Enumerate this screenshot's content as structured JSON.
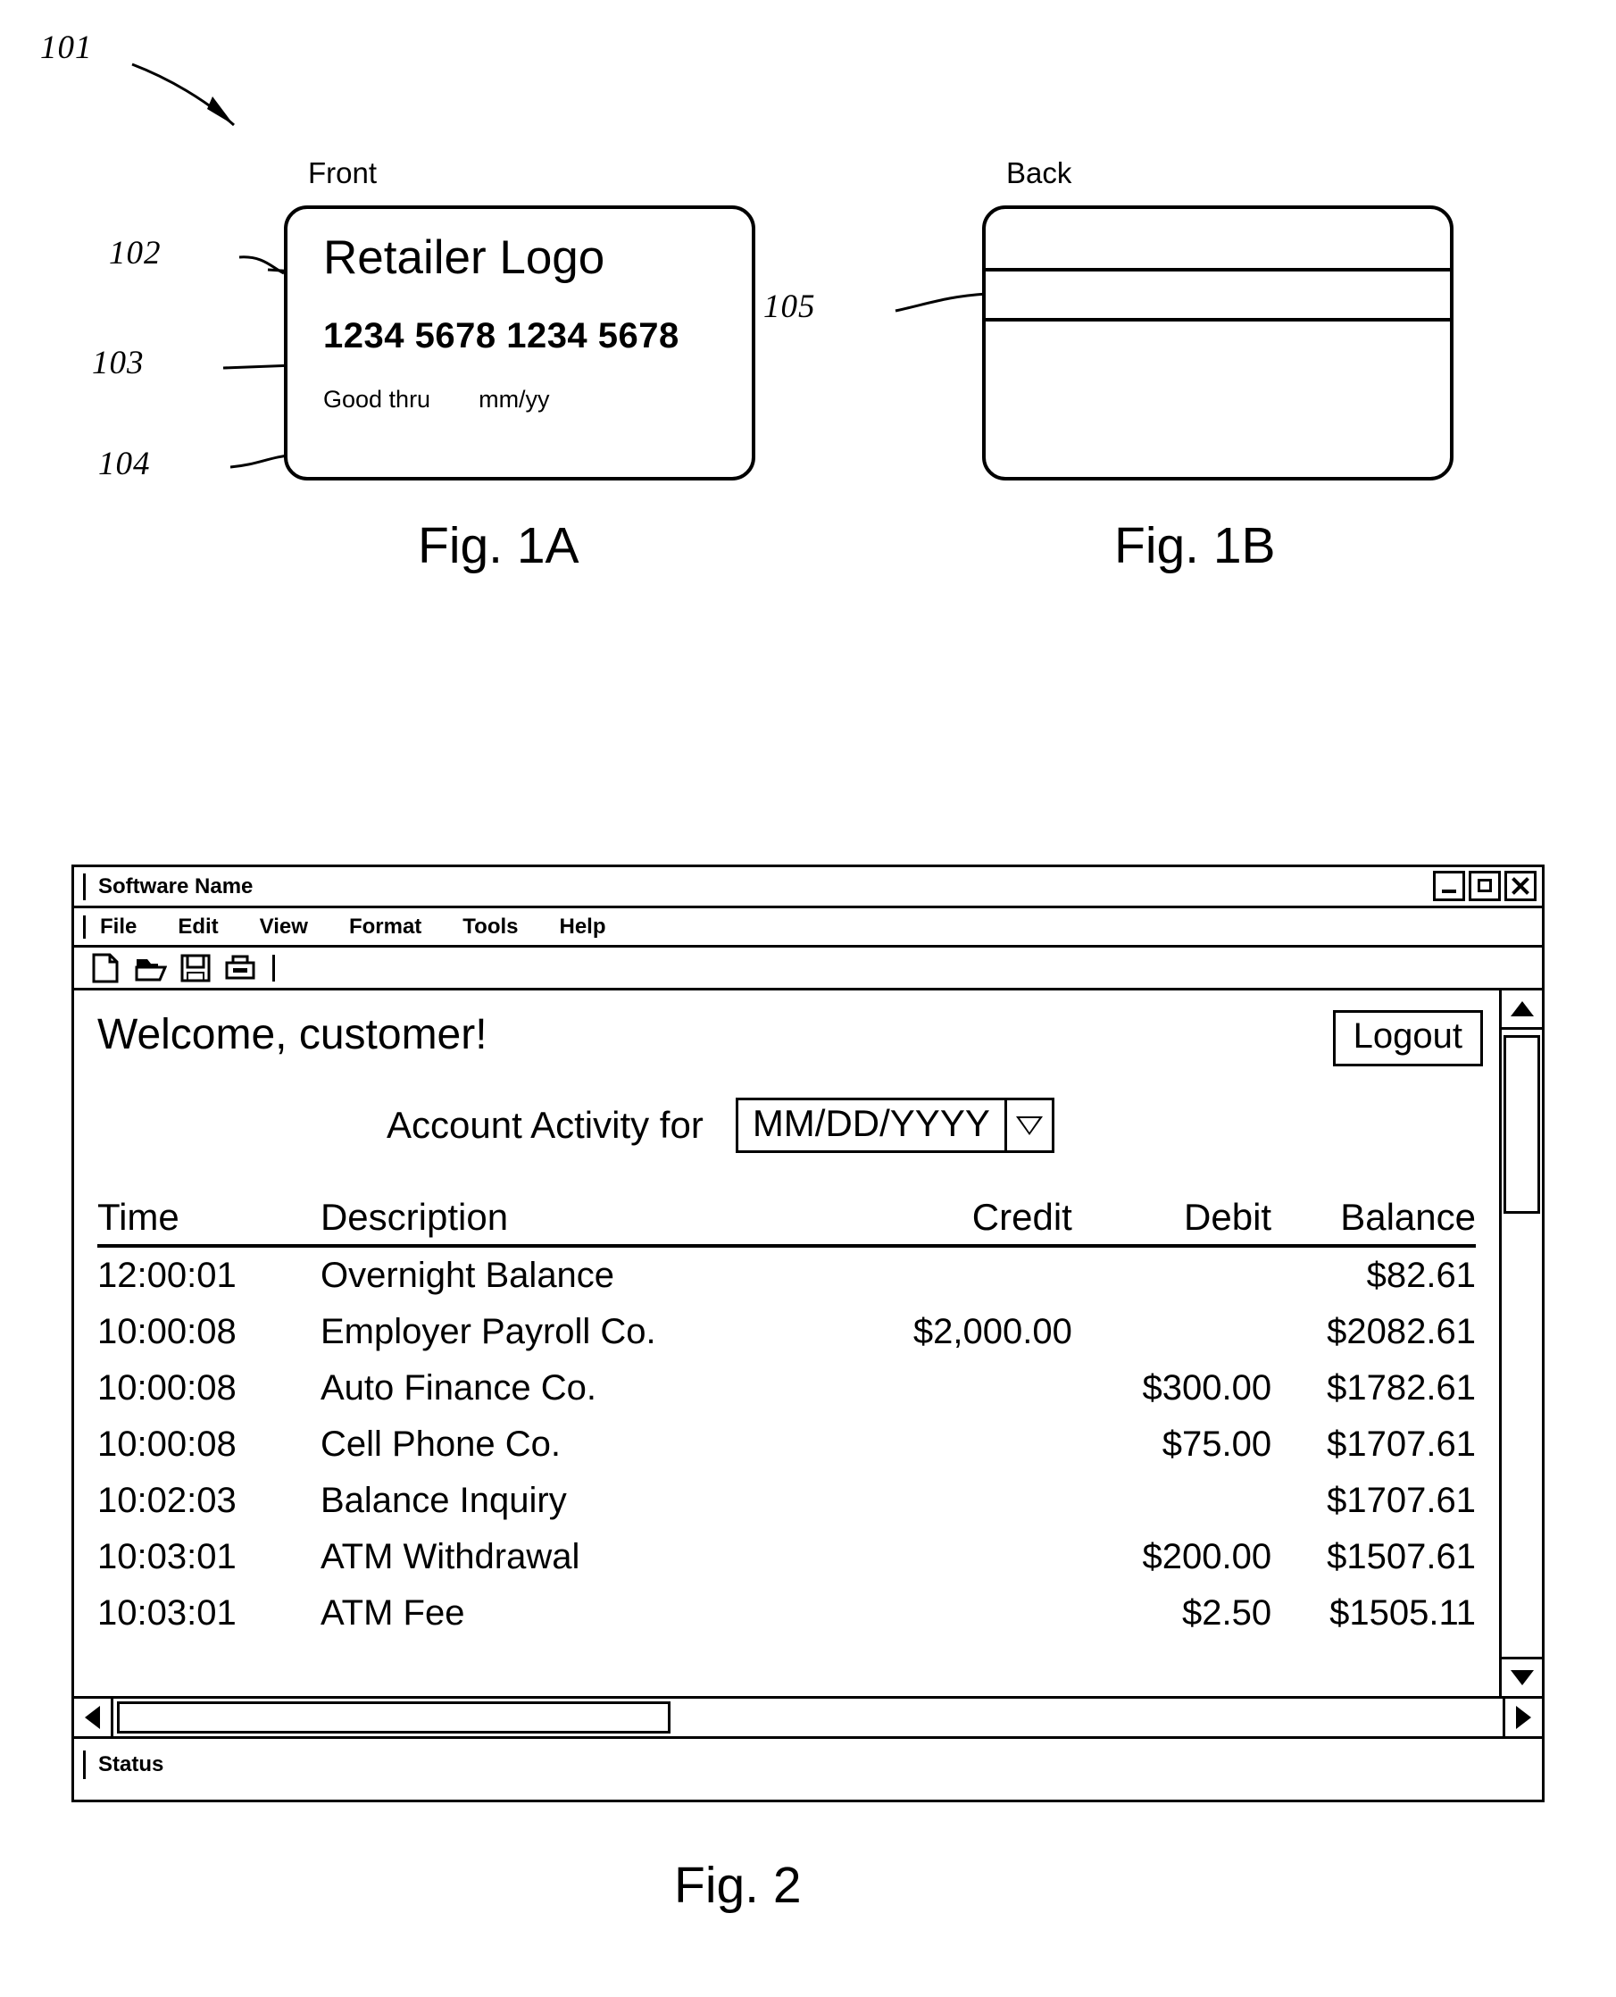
{
  "figure_101_ref": "101",
  "fig1a": {
    "caption": "Fig. 1A",
    "side_label": "Front",
    "refs": {
      "logo": "102",
      "number": "103",
      "expiry": "104"
    },
    "logo_text": "Retailer Logo",
    "card_number": "1234 5678 1234 5678",
    "good_thru_label": "Good thru",
    "good_thru_value": "mm/yy"
  },
  "fig1b": {
    "caption": "Fig. 1B",
    "side_label": "Back",
    "refs": {
      "magstripe": "105"
    }
  },
  "fig2": {
    "caption": "Fig. 2",
    "window": {
      "title": "Software Name",
      "controls": {
        "minimize": "minimize-button",
        "maximize": "maximize-button",
        "close": "close-button"
      },
      "menus": [
        "File",
        "Edit",
        "View",
        "Format",
        "Tools",
        "Help"
      ],
      "toolbar_icons": [
        "new-document-icon",
        "open-folder-icon",
        "save-floppy-icon",
        "print-icon"
      ],
      "status": "Status"
    },
    "content": {
      "welcome": "Welcome, customer!",
      "logout_label": "Logout",
      "activity_label": "Account Activity for",
      "date_value": "MM/DD/YYYY",
      "date_dropdown_icon": "chevron-down-icon",
      "columns": [
        "Time",
        "Description",
        "Credit",
        "Debit",
        "Balance"
      ],
      "rows": [
        {
          "time": "12:00:01",
          "description": "Overnight Balance",
          "credit": "",
          "debit": "",
          "balance": "$82.61"
        },
        {
          "time": "10:00:08",
          "description": "Employer Payroll Co.",
          "credit": "$2,000.00",
          "debit": "",
          "balance": "$2082.61"
        },
        {
          "time": "10:00:08",
          "description": "Auto Finance Co.",
          "credit": "",
          "debit": "$300.00",
          "balance": "$1782.61"
        },
        {
          "time": "10:00:08",
          "description": "Cell Phone Co.",
          "credit": "",
          "debit": "$75.00",
          "balance": "$1707.61"
        },
        {
          "time": "10:02:03",
          "description": "Balance Inquiry",
          "credit": "",
          "debit": "",
          "balance": "$1707.61"
        },
        {
          "time": "10:03:01",
          "description": "ATM Withdrawal",
          "credit": "",
          "debit": "$200.00",
          "balance": "$1507.61"
        },
        {
          "time": "10:03:01",
          "description": "ATM Fee",
          "credit": "",
          "debit": "$2.50",
          "balance": "$1505.11"
        }
      ]
    }
  }
}
